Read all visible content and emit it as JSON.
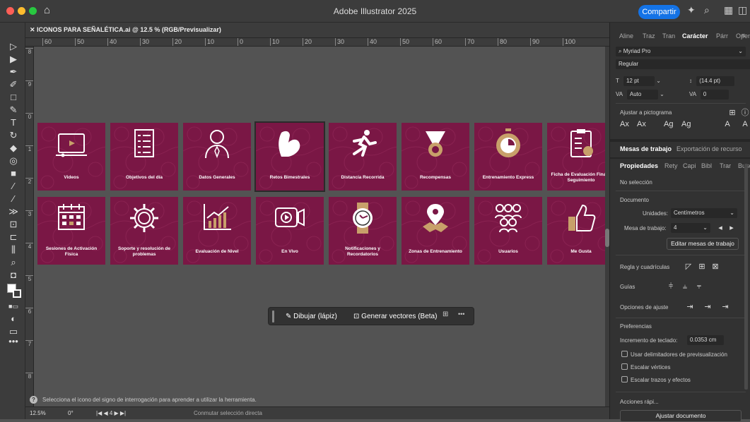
{
  "app": {
    "title": "Adobe Illustrator 2025",
    "share_label": "Compartir"
  },
  "document": {
    "tab_label": "ICONOS PARA SEÑALÉTICA.ai @ 12.5 % (RGB/Previsualizar)"
  },
  "rulers": {
    "horizontal": [
      "60",
      "50",
      "40",
      "30",
      "20",
      "10",
      "0",
      "10",
      "20",
      "30",
      "40",
      "50",
      "60",
      "70",
      "80",
      "90",
      "100"
    ],
    "vertical": [
      "8",
      "9",
      "0",
      "1",
      "2",
      "3",
      "4",
      "5",
      "6",
      "7",
      "8"
    ]
  },
  "cards_row1": [
    {
      "label": "Videos",
      "icon": "video-icon"
    },
    {
      "label": "Objetivos del día",
      "icon": "checklist-icon"
    },
    {
      "label": "Datos Generales",
      "icon": "user-icon"
    },
    {
      "label": "Retos Bimestrales",
      "icon": "muscle-icon"
    },
    {
      "label": "Distancia Recorrida",
      "icon": "runner-icon"
    },
    {
      "label": "Recompensas",
      "icon": "medal-icon"
    },
    {
      "label": "Entrenamiento Express",
      "icon": "stopwatch-icon"
    },
    {
      "label": "Ficha de Evaluación Final y Seguimiento",
      "icon": "clipboard-icon"
    }
  ],
  "cards_row2": [
    {
      "label": "Sesiones de Activación Física",
      "icon": "calendar-icon"
    },
    {
      "label": "Soporte y resolución de problemas",
      "icon": "gear-icon"
    },
    {
      "label": "Evaluación de Nivel",
      "icon": "chart-icon"
    },
    {
      "label": "En Vivo",
      "icon": "live-video-icon"
    },
    {
      "label": "Notificaciones y Recordatorios",
      "icon": "watch-icon"
    },
    {
      "label": "Zonas de Entrenamiento",
      "icon": "map-pin-icon"
    },
    {
      "label": "Usuarios",
      "icon": "users-icon"
    },
    {
      "label": "Me Gusta",
      "icon": "thumbs-up-icon"
    }
  ],
  "context_bar": {
    "draw_label": "Dibujar (lápiz)",
    "vectorize_label": "Generar vectores (Beta)",
    "more": "•••"
  },
  "statusbar": {
    "hint": "Selecciona el icono del signo de interrogación para aprender a utilizar la herramienta.",
    "zoom": "12.5%",
    "rotation": "0°",
    "artboard": "4",
    "tool": "Conmutar selección directa"
  },
  "panel": {
    "top_tabs": [
      "Aline",
      "Traz",
      "Tran",
      "Carácter",
      "Párr",
      "Open"
    ],
    "font_family": "Myriad Pro",
    "font_style": "Regular",
    "font_size": "12 pt",
    "leading": "(14.4 pt)",
    "kerning": "Auto",
    "tracking": "0",
    "snap_label": "Ajustar a pictograma",
    "section_tabs": [
      "Mesas de trabajo",
      "Exportación de recurso"
    ],
    "props_tabs": [
      "Propiedades",
      "Rety",
      "Capi",
      "Bibl",
      "Trar",
      "Busc"
    ],
    "no_selection": "No selección",
    "document_label": "Documento",
    "units_label": "Unidades:",
    "units_value": "Centímetros",
    "artboard_label": "Mesa de trabajo:",
    "artboard_value": "4",
    "edit_artboards": "Editar mesas de trabajo",
    "rulers_grids": "Regla y cuadrículas",
    "guides": "Guías",
    "snap_options": "Opciones de ajuste",
    "preferences": "Preferencias",
    "keyboard_increment_label": "Incremento de teclado:",
    "keyboard_increment_value": "0.0353 cm",
    "checkbox_preview_bounds": "Usar delimitadores de previsualización",
    "checkbox_scale_corners": "Escalar vértices",
    "checkbox_scale_strokes": "Escalar trazos y efectos",
    "quick_actions": "Acciones rápi...",
    "fit_document": "Ajustar documento"
  },
  "colors": {
    "card": "#7a1745",
    "accent_gold": "#a87a3d",
    "share_blue": "#1473e6"
  }
}
